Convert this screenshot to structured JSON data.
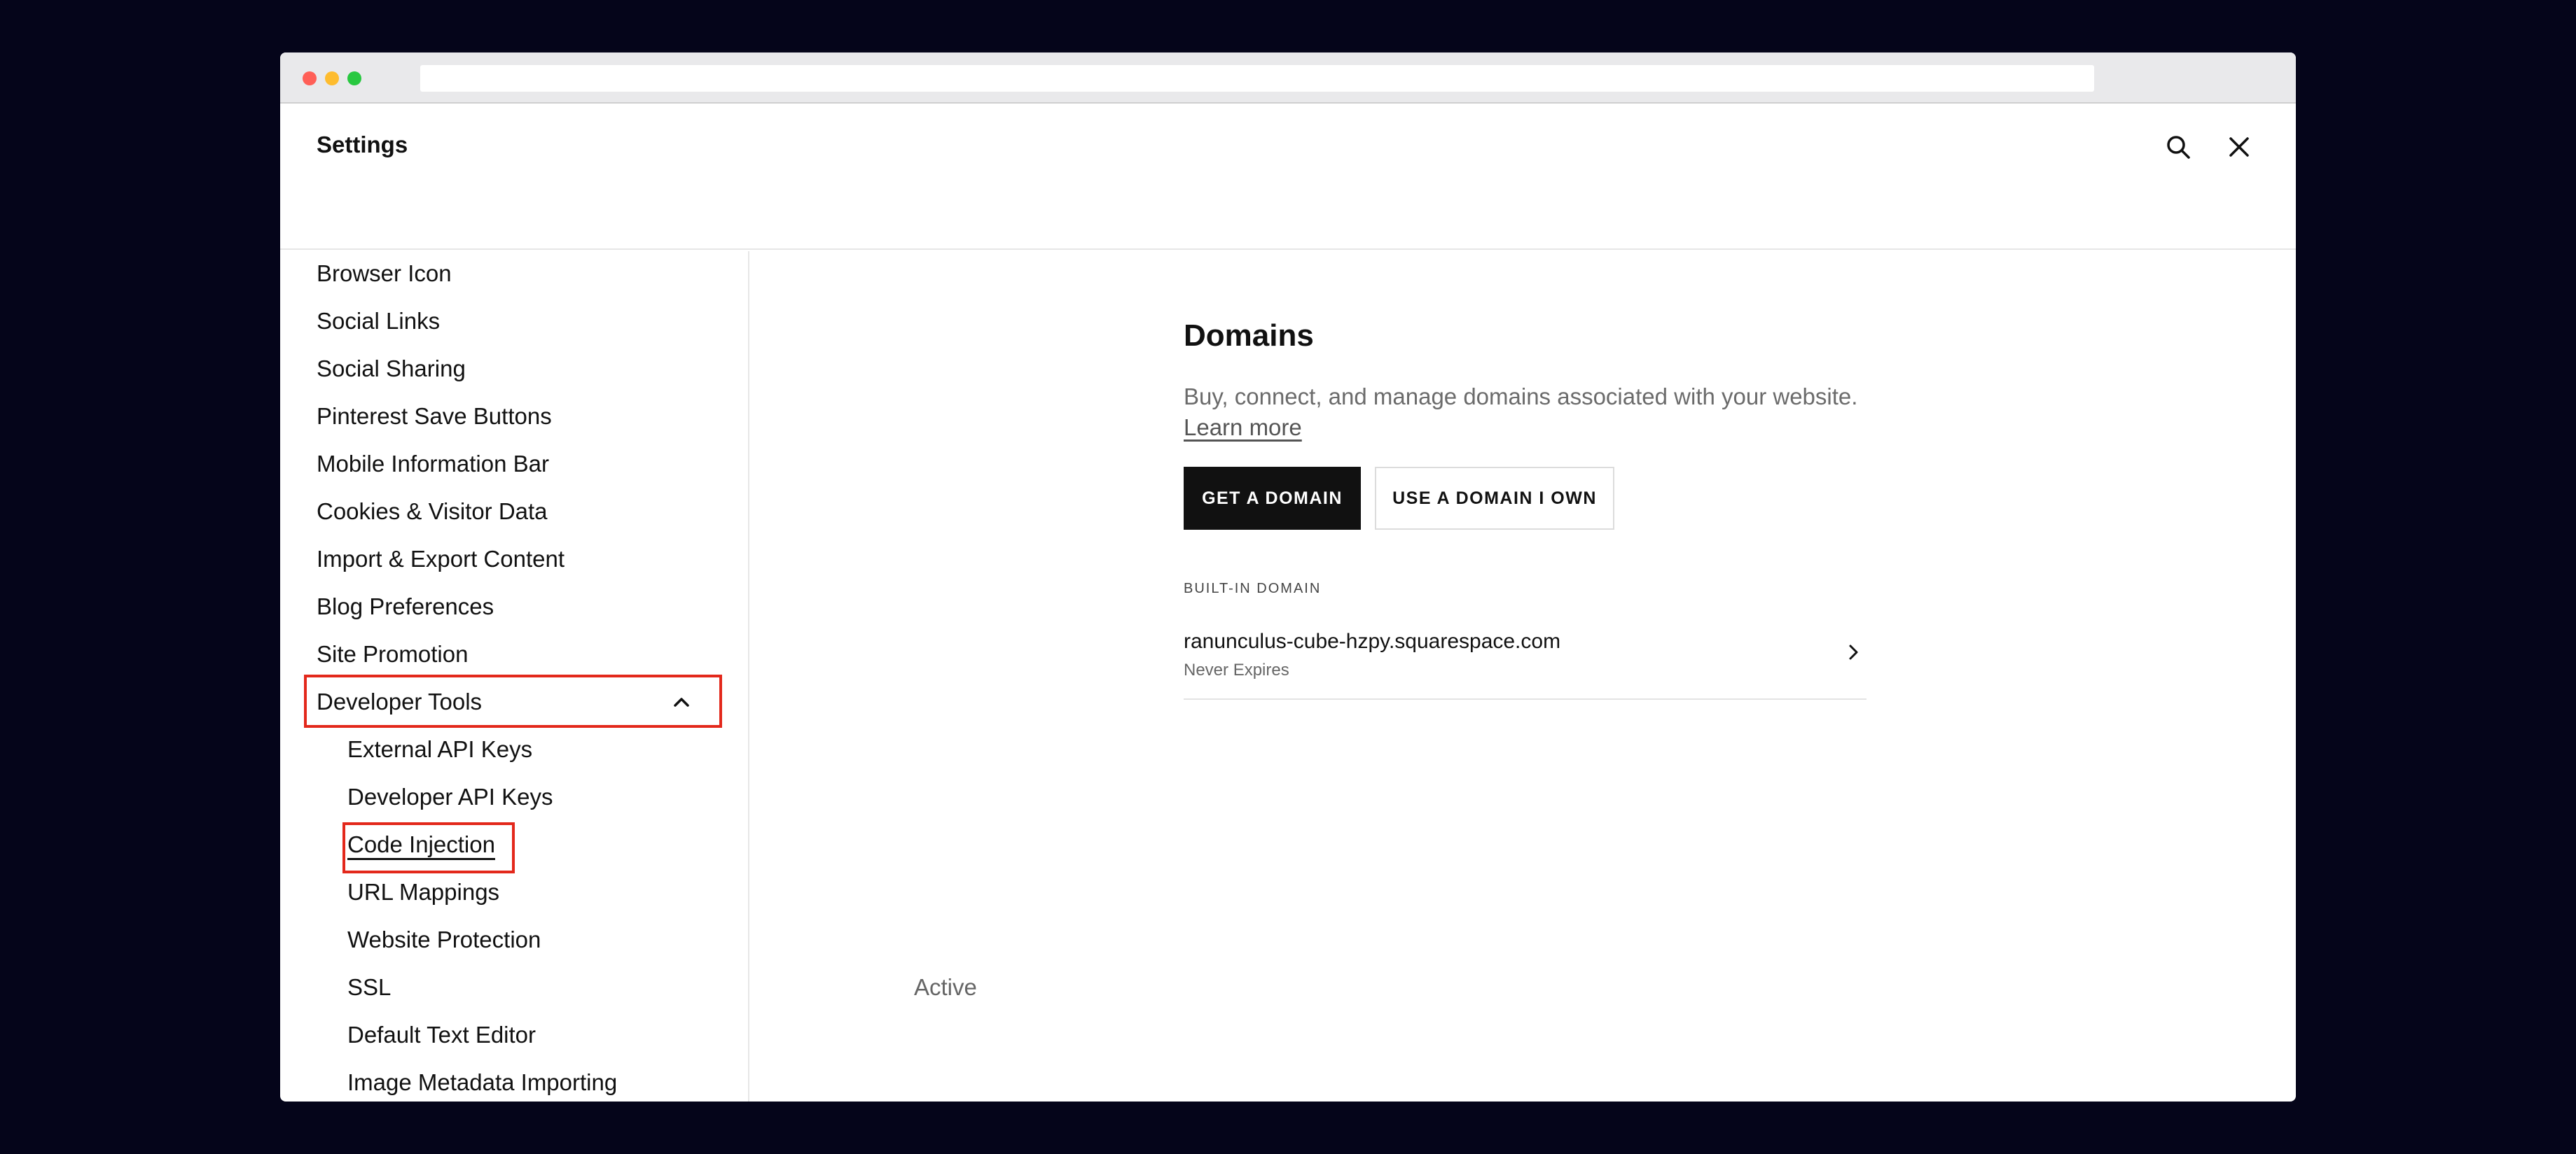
{
  "header": {
    "title": "Settings"
  },
  "icons": {
    "search": "search-icon",
    "close": "close-icon",
    "chevron_up": "chevron-up-icon",
    "chevron_right": "chevron-right-icon"
  },
  "sidebar": {
    "items": [
      {
        "label": "Browser Icon"
      },
      {
        "label": "Social Links"
      },
      {
        "label": "Social Sharing"
      },
      {
        "label": "Pinterest Save Buttons"
      },
      {
        "label": "Mobile Information Bar"
      },
      {
        "label": "Cookies & Visitor Data"
      },
      {
        "label": "Import & Export Content"
      },
      {
        "label": "Blog Preferences"
      },
      {
        "label": "Site Promotion"
      },
      {
        "label": "Developer Tools"
      }
    ],
    "sub_items": [
      {
        "label": "External API Keys"
      },
      {
        "label": "Developer API Keys"
      },
      {
        "label": "Code Injection"
      },
      {
        "label": "URL Mappings"
      },
      {
        "label": "Website Protection"
      },
      {
        "label": "SSL",
        "status": "Active"
      },
      {
        "label": "Default Text Editor"
      },
      {
        "label": "Image Metadata Importing"
      }
    ]
  },
  "main": {
    "title": "Domains",
    "description": "Buy, connect, and manage domains associated with your website.",
    "learn_more": "Learn more",
    "btn_get": "GET A DOMAIN",
    "btn_use": "USE A DOMAIN I OWN",
    "builtin_label": "BUILT-IN DOMAIN",
    "domain": {
      "name": "ranunculus-cube-hzpy.squarespace.com",
      "expiry": "Never Expires"
    }
  },
  "colors": {
    "highlight": "#e3281b",
    "primary_button": "#111111",
    "page_bg": "#05051a"
  }
}
